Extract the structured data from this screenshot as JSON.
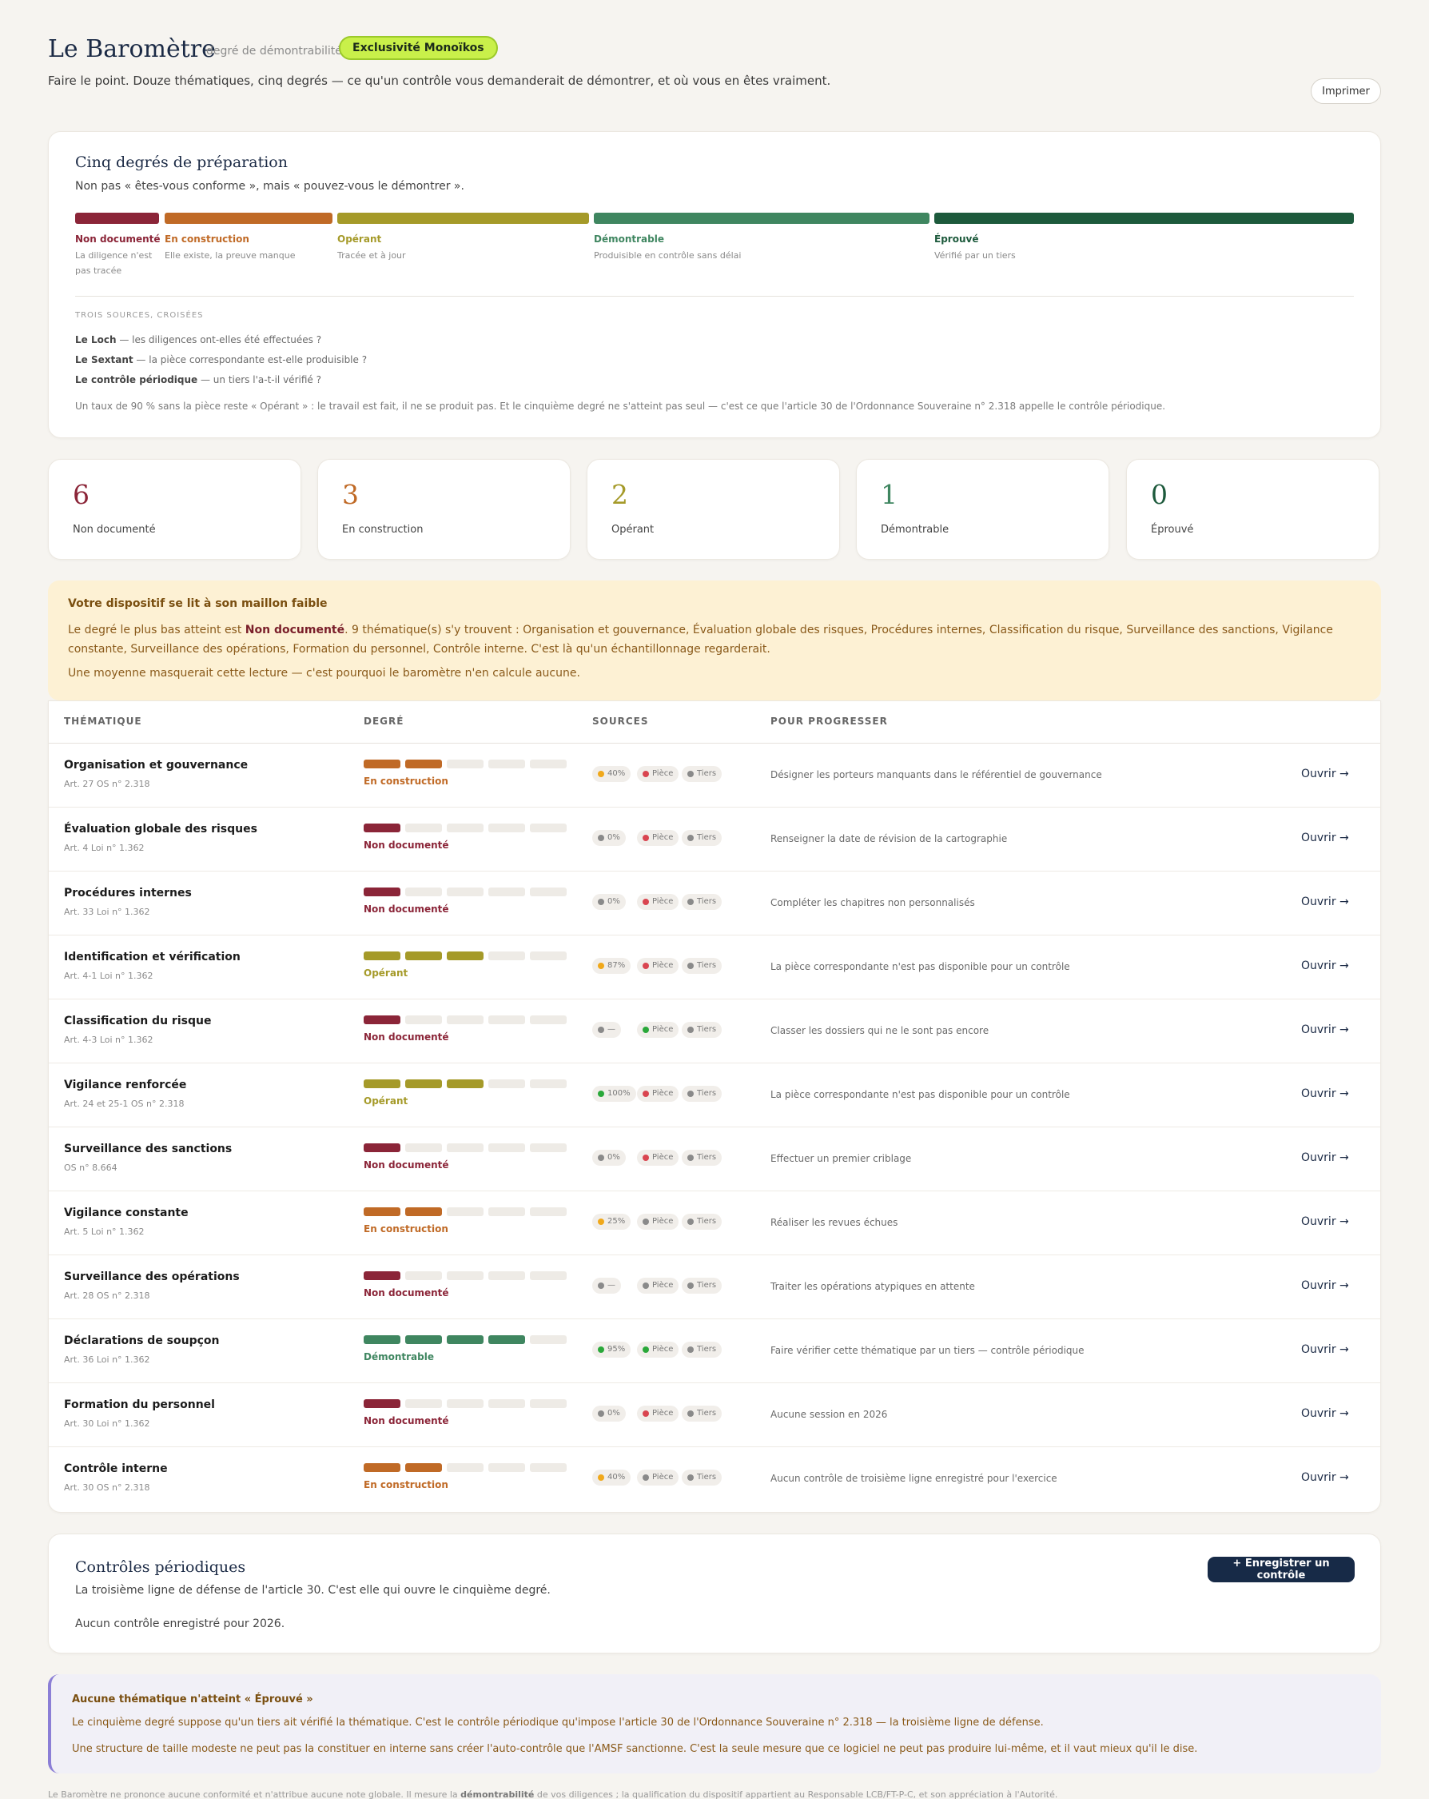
{
  "colors": {
    "non_documente": "#8b2538",
    "en_construction": "#c06a26",
    "operant": "#a59a29",
    "demontrable": "#3f8660",
    "eprouve": "#1d5a3c",
    "empty_segment": "#eeebe6",
    "dot_orange": "#f0a81a",
    "dot_red": "#d94550",
    "dot_grey": "#8a8a8a",
    "dot_green": "#2aa83a"
  },
  "header": {
    "title": "Le Baromètre",
    "subtitle": "degré de démontrabilité",
    "badge": "Exclusivité Monoïkos",
    "description": "Faire le point. Douze thématiques, cinq degrés — ce qu'un contrôle vous demanderait de démontrer, et où vous en êtes vraiment.",
    "print_label": "Imprimer"
  },
  "degrees": {
    "title": "Cinq degrés de préparation",
    "subtitle": "Non pas « êtes-vous conforme », mais « pouvez-vous le démontrer ».",
    "scale": [
      {
        "name": "Non documenté",
        "desc1": "La diligence n'est",
        "desc2": "pas tracée"
      },
      {
        "name": "En construction",
        "desc1": "Elle existe, la preuve manque",
        "desc2": ""
      },
      {
        "name": "Opérant",
        "desc1": "Tracée et à jour",
        "desc2": ""
      },
      {
        "name": "Démontrable",
        "desc1": "Produisible en contrôle sans délai",
        "desc2": ""
      },
      {
        "name": "Éprouvé",
        "desc1": "Vérifié par un tiers",
        "desc2": ""
      }
    ],
    "sources_heading": "TROIS SOURCES, CROISÉES",
    "sources": [
      {
        "name": "Le Loch",
        "text": " — les diligences ont-elles été effectuées ?"
      },
      {
        "name": "Le Sextant",
        "text": " — la pièce correspondante est-elle produisible ?"
      },
      {
        "name": "Le contrôle périodique",
        "text": " — un tiers l'a-t-il vérifié ?"
      }
    ],
    "note": "Un taux de 90 % sans la pièce reste « Opérant » : le travail est fait, il ne se produit pas. Et le cinquième degré ne s'atteint pas seul — c'est ce que l'article 30 de l'Ordonnance Souveraine n° 2.318 appelle le contrôle périodique."
  },
  "stats": [
    {
      "value": "6",
      "label": "Non documenté"
    },
    {
      "value": "3",
      "label": "En construction"
    },
    {
      "value": "2",
      "label": "Opérant"
    },
    {
      "value": "1",
      "label": "Démontrable"
    },
    {
      "value": "0",
      "label": "Éprouvé"
    }
  ],
  "warning": {
    "title": "Votre dispositif se lit à son maillon faible",
    "body_pre": "Le degré le plus bas atteint est ",
    "body_bold": "Non documenté",
    "body_post": ". 9 thématique(s) s'y trouvent : Organisation et gouvernance, Évaluation globale des risques, Procédures internes, Classification du risque, Surveillance des sanctions, Vigilance constante, Surveillance des opérations, Formation du personnel, Contrôle interne. C'est là qu'un échantillonnage regarderait.",
    "footer": "Une moyenne masquerait cette lecture — c'est pourquoi le baromètre n'en calcule aucune."
  },
  "table": {
    "headers": [
      "THÉMATIQUE",
      "DEGRÉ",
      "SOURCES",
      "POUR PROGRESSER"
    ],
    "open_label": "Ouvrir →",
    "rows": [
      {
        "name": "Organisation et gouvernance",
        "law": "Art. 27 OS n° 2.318",
        "filled": 2,
        "level": "en_construction",
        "degree": "En construction",
        "p1": "40%",
        "d1": "dot_orange",
        "p2": "Pièce",
        "d2": "dot_red",
        "p3": "Tiers",
        "d3": "dot_grey",
        "progress": "Désigner les porteurs manquants dans le référentiel de gouvernance"
      },
      {
        "name": "Évaluation globale des risques",
        "law": "Art. 4 Loi n° 1.362",
        "filled": 1,
        "level": "non_documente",
        "degree": "Non documenté",
        "p1": "0%",
        "d1": "dot_grey",
        "p2": "Pièce",
        "d2": "dot_red",
        "p3": "Tiers",
        "d3": "dot_grey",
        "progress": "Renseigner la date de révision de la cartographie"
      },
      {
        "name": "Procédures internes",
        "law": "Art. 33 Loi n° 1.362",
        "filled": 1,
        "level": "non_documente",
        "degree": "Non documenté",
        "p1": "0%",
        "d1": "dot_grey",
        "p2": "Pièce",
        "d2": "dot_red",
        "p3": "Tiers",
        "d3": "dot_grey",
        "progress": "Compléter les chapitres non personnalisés"
      },
      {
        "name": "Identification et vérification",
        "law": "Art. 4-1 Loi n° 1.362",
        "filled": 3,
        "level": "operant",
        "degree": "Opérant",
        "p1": "87%",
        "d1": "dot_orange",
        "p2": "Pièce",
        "d2": "dot_red",
        "p3": "Tiers",
        "d3": "dot_grey",
        "progress": "La pièce correspondante n'est pas disponible pour un contrôle"
      },
      {
        "name": "Classification du risque",
        "law": "Art. 4-3 Loi n° 1.362",
        "filled": 1,
        "level": "non_documente",
        "degree": "Non documenté",
        "p1": "—",
        "d1": "dot_grey",
        "p2": "Pièce",
        "d2": "dot_green",
        "p3": "Tiers",
        "d3": "dot_grey",
        "progress": "Classer les dossiers qui ne le sont pas encore"
      },
      {
        "name": "Vigilance renforcée",
        "law": "Art. 24 et 25-1 OS n° 2.318",
        "filled": 3,
        "level": "operant",
        "degree": "Opérant",
        "p1": "100%",
        "d1": "dot_green",
        "p2": "Pièce",
        "d2": "dot_red",
        "p3": "Tiers",
        "d3": "dot_grey",
        "progress": "La pièce correspondante n'est pas disponible pour un contrôle"
      },
      {
        "name": "Surveillance des sanctions",
        "law": "OS n° 8.664",
        "filled": 1,
        "level": "non_documente",
        "degree": "Non documenté",
        "p1": "0%",
        "d1": "dot_grey",
        "p2": "Pièce",
        "d2": "dot_red",
        "p3": "Tiers",
        "d3": "dot_grey",
        "progress": "Effectuer un premier criblage"
      },
      {
        "name": "Vigilance constante",
        "law": "Art. 5 Loi n° 1.362",
        "filled": 2,
        "level": "en_construction",
        "degree": "En construction",
        "p1": "25%",
        "d1": "dot_orange",
        "p2": "Pièce",
        "d2": "dot_grey",
        "p3": "Tiers",
        "d3": "dot_grey",
        "progress": "Réaliser les revues échues"
      },
      {
        "name": "Surveillance des opérations",
        "law": "Art. 28 OS n° 2.318",
        "filled": 1,
        "level": "non_documente",
        "degree": "Non documenté",
        "p1": "—",
        "d1": "dot_grey",
        "p2": "Pièce",
        "d2": "dot_grey",
        "p3": "Tiers",
        "d3": "dot_grey",
        "progress": "Traiter les opérations atypiques en attente"
      },
      {
        "name": "Déclarations de soupçon",
        "law": "Art. 36 Loi n° 1.362",
        "filled": 4,
        "level": "demontrable",
        "degree": "Démontrable",
        "p1": "95%",
        "d1": "dot_green",
        "p2": "Pièce",
        "d2": "dot_green",
        "p3": "Tiers",
        "d3": "dot_grey",
        "progress": "Faire vérifier cette thématique par un tiers — contrôle périodique"
      },
      {
        "name": "Formation du personnel",
        "law": "Art. 30 Loi n° 1.362",
        "filled": 1,
        "level": "non_documente",
        "degree": "Non documenté",
        "p1": "0%",
        "d1": "dot_grey",
        "p2": "Pièce",
        "d2": "dot_red",
        "p3": "Tiers",
        "d3": "dot_grey",
        "progress": "Aucune session en 2026"
      },
      {
        "name": "Contrôle interne",
        "law": "Art. 30 OS n° 2.318",
        "filled": 2,
        "level": "en_construction",
        "degree": "En construction",
        "p1": "40%",
        "d1": "dot_orange",
        "p2": "Pièce",
        "d2": "dot_grey",
        "p3": "Tiers",
        "d3": "dot_grey",
        "progress": "Aucun contrôle de troisième ligne enregistré pour l'exercice"
      }
    ]
  },
  "controls": {
    "title": "Contrôles périodiques",
    "subtitle": "La troisième ligne de défense de l'article 30. C'est elle qui ouvre le cinquième degré.",
    "empty": "Aucun contrôle enregistré pour 2026.",
    "button": "+ Enregistrer un contrôle"
  },
  "note": {
    "title": "Aucune thématique n'atteint « Éprouvé »",
    "line1": "Le cinquième degré suppose qu'un tiers ait vérifié la thématique. C'est le contrôle périodique qu'impose l'article 30 de l'Ordonnance Souveraine n° 2.318 — la troisième ligne de défense.",
    "line2": "Une structure de taille modeste ne peut pas la constituer en interne sans créer l'auto-contrôle que l'AMSF sanctionne. C'est la seule mesure que ce logiciel ne peut pas produire lui-même, et il vaut mieux qu'il le dise."
  },
  "footer": {
    "pre": "Le Baromètre ne prononce aucune conformité et n'attribue aucune note globale. Il mesure la ",
    "bold": "démontrabilité",
    "post": " de vos diligences ; la qualification du dispositif appartient au Responsable LCB/FT-P-C, et son appréciation à l'Autorité."
  }
}
